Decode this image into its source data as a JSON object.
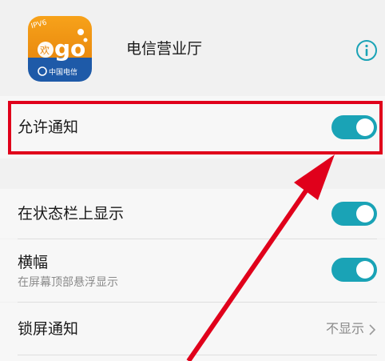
{
  "app": {
    "name": "电信营业厅",
    "icon": {
      "name": "china-telecom-ogo-logo-icon",
      "badge_text": "IPV6",
      "brand_text": "go",
      "round_text": "欢",
      "footer_text": "中国电信"
    },
    "info_icon": "info-icon"
  },
  "settings": {
    "allow_notifications": {
      "label": "允许通知",
      "enabled": true
    },
    "status_bar": {
      "label": "在状态栏上显示",
      "enabled": true
    },
    "banner": {
      "label": "横幅",
      "sublabel": "在屏幕顶部悬浮显示",
      "enabled": true
    },
    "lock_screen": {
      "label": "锁屏通知",
      "value": "不显示"
    }
  },
  "colors": {
    "toggle_on": "#1aa3b6",
    "annotation_red": "#e0001b",
    "background": "#f1f1f1"
  }
}
